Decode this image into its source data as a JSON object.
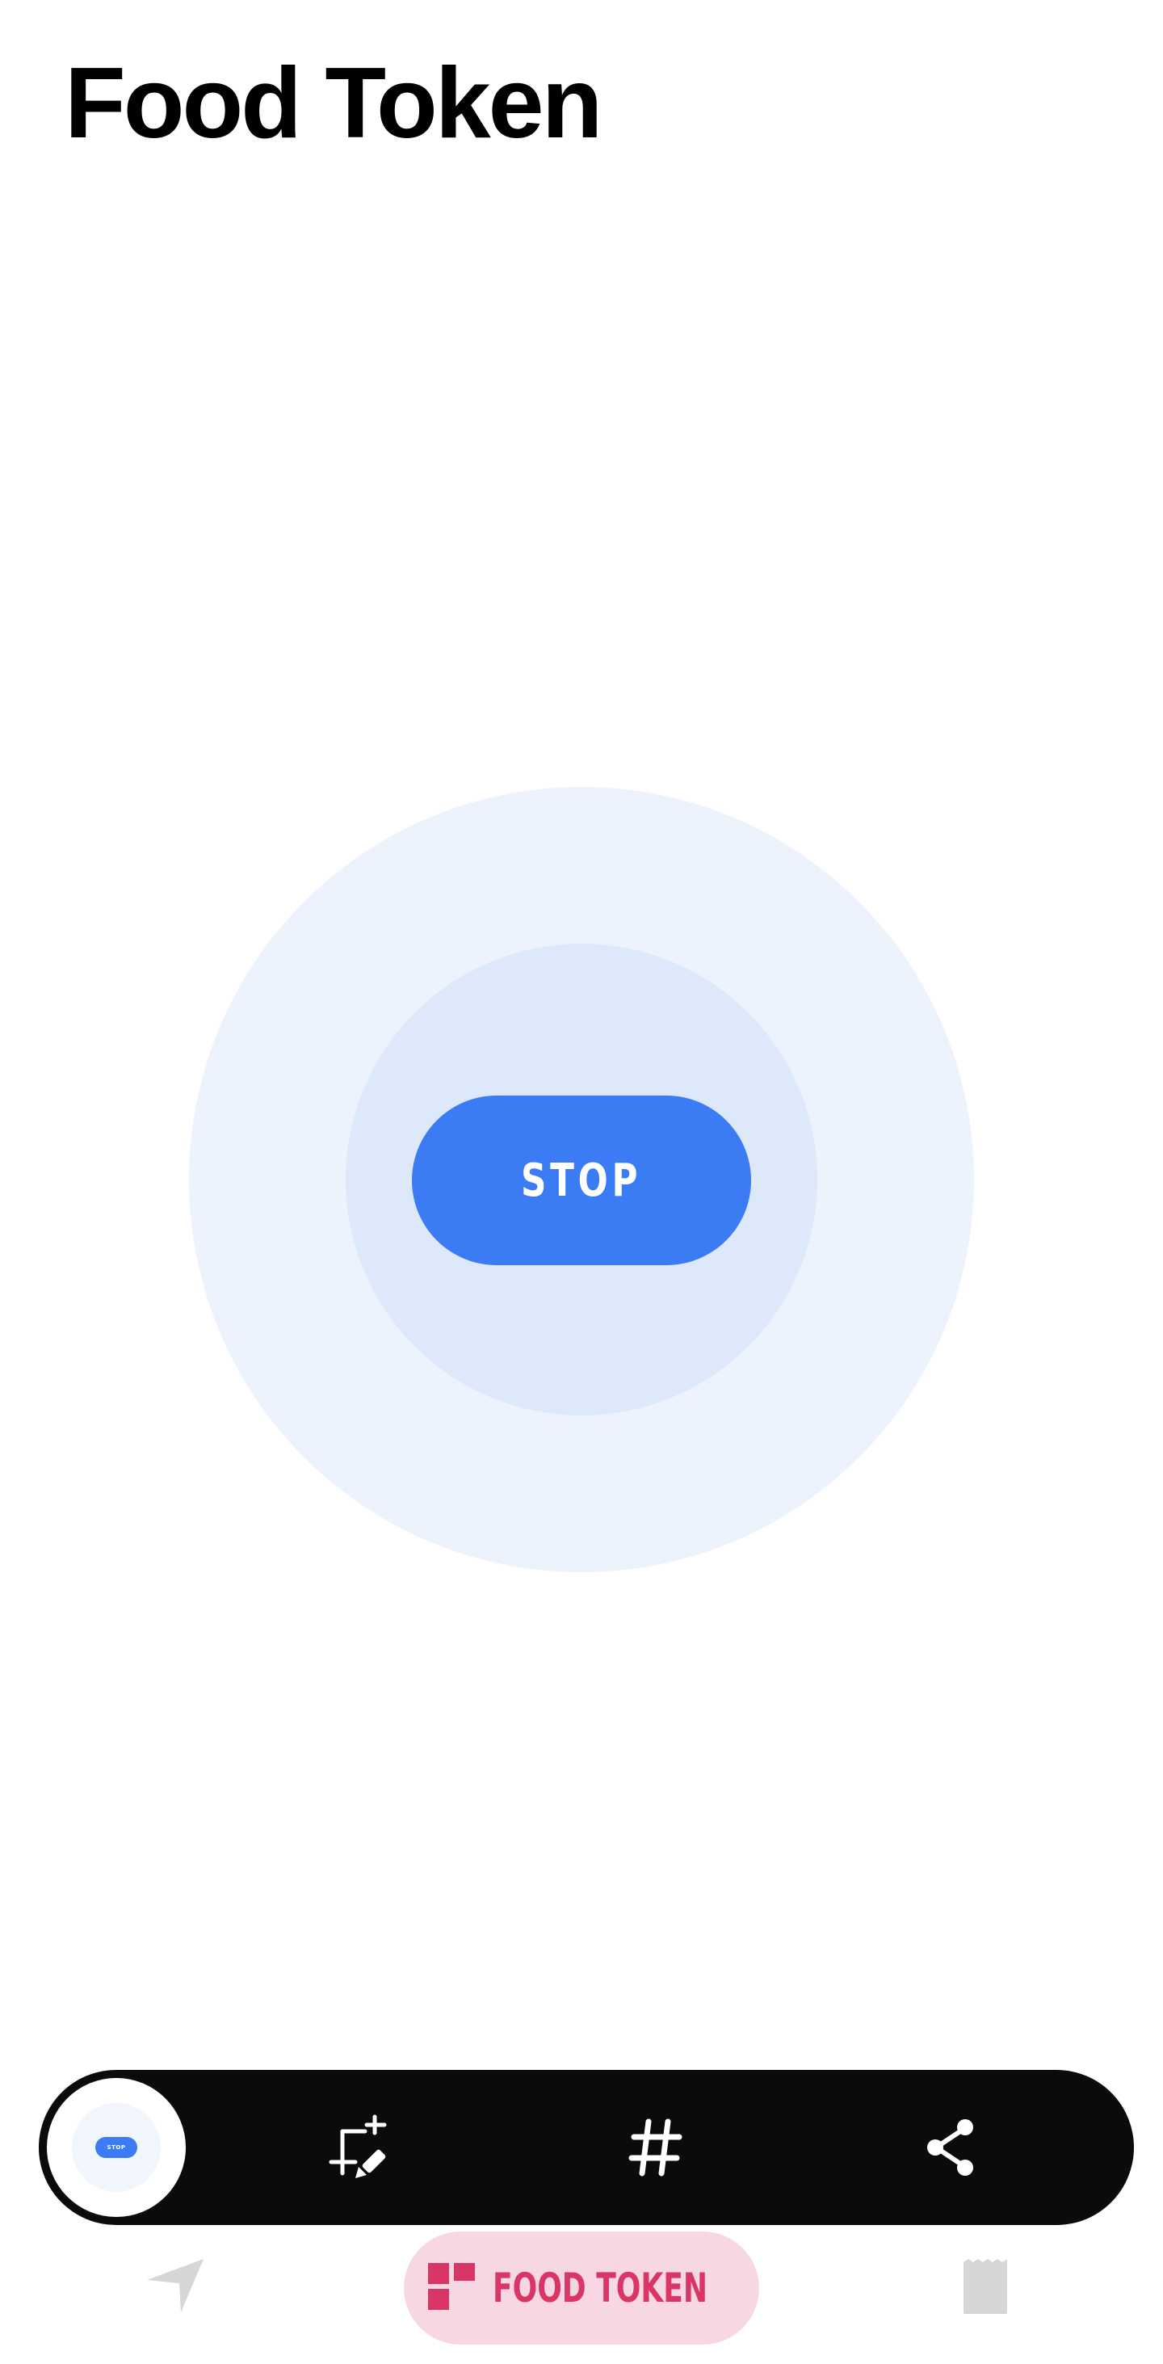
{
  "app": {
    "title": "Food Token"
  },
  "main": {
    "stop_button_label": "STOP"
  },
  "toolbar": {
    "thumbnail": {
      "label": "STOP"
    },
    "items": [
      {
        "icon": "crop-edit-icon"
      },
      {
        "icon": "hashtag-icon"
      },
      {
        "icon": "share-icon"
      }
    ]
  },
  "bottom_nav": {
    "left_icon": "navigation-arrow-icon",
    "active": {
      "icon": "dashboard-icon",
      "label": "FOOD TOKEN"
    },
    "right_icon": "receipt-icon"
  },
  "colors": {
    "accent_blue": "#3b7cf5",
    "pulse_outer": "#edf3fd",
    "pulse_inner": "#dde8fa",
    "toolbar_bg": "#0b0b0b",
    "nav_active_bg": "#f8d7e4",
    "nav_active_fg": "#d93567",
    "nav_inactive": "#d6d6d6"
  }
}
